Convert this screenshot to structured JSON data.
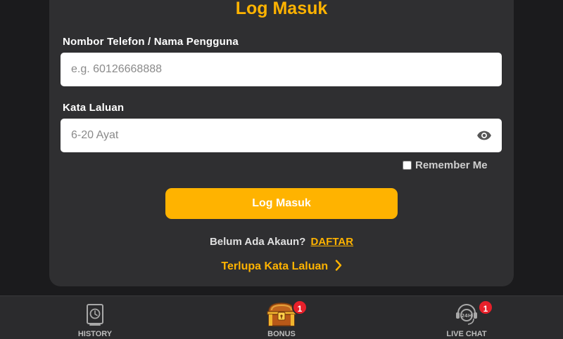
{
  "login": {
    "title": "Log Masuk",
    "username_label": "Nombor Telefon / Nama Pengguna",
    "username_placeholder": "e.g. 60126668888",
    "password_label": "Kata Laluan",
    "password_placeholder": "6-20 Ayat",
    "remember_label": "Remember Me",
    "submit_label": "Log Masuk",
    "no_account_text": "Belum Ada Akaun?",
    "register_link": "DAFTAR",
    "forgot_link": "Terlupa Kata Laluan"
  },
  "bottom_nav": {
    "items": [
      {
        "label": "HISTORY",
        "icon": "history-icon"
      },
      {
        "label": "BONUS",
        "icon": "treasure-chest-icon",
        "badge": "1"
      },
      {
        "label": "LIVE CHAT",
        "icon": "live-chat-24h-icon",
        "badge": "1"
      }
    ]
  },
  "colors": {
    "accent": "#ffb300",
    "card": "#2f2f31",
    "background": "#1b1b1d",
    "badge": "#e8202a"
  }
}
